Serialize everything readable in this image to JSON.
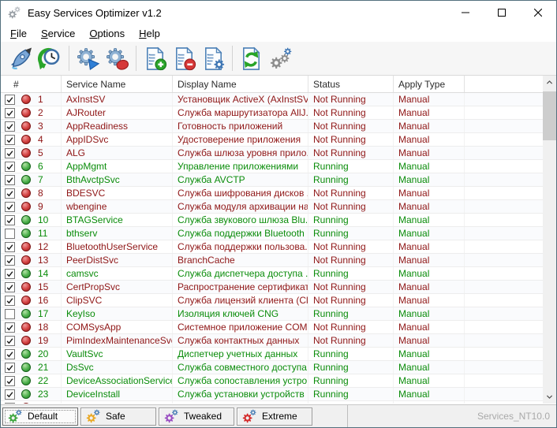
{
  "window": {
    "title": "Easy Services Optimizer v1.2"
  },
  "menu": {
    "items": [
      {
        "label": "File"
      },
      {
        "label": "Service"
      },
      {
        "label": "Options"
      },
      {
        "label": "Help"
      }
    ]
  },
  "toolbar": {
    "icons": [
      "rocket-icon",
      "history-clock-icon",
      "start-service-gear-icon",
      "stop-service-gear-icon",
      "add-service-doc-icon",
      "remove-service-doc-icon",
      "configure-service-doc-icon",
      "refresh-doc-icon",
      "settings-gears-icon"
    ]
  },
  "table": {
    "columns": [
      "#",
      "Service Name",
      "Display Name",
      "Status",
      "Apply Type"
    ],
    "rows": [
      {
        "num": "1",
        "checked": true,
        "state": "stopped",
        "service": "AxInstSV",
        "display": "Установщик ActiveX (AxInstSV)",
        "status": "Not Running",
        "apply": "Manual"
      },
      {
        "num": "2",
        "checked": true,
        "state": "stopped",
        "service": "AJRouter",
        "display": "Служба маршрутизатора AllJ...",
        "status": "Not Running",
        "apply": "Manual"
      },
      {
        "num": "3",
        "checked": true,
        "state": "stopped",
        "service": "AppReadiness",
        "display": "Готовность приложений",
        "status": "Not Running",
        "apply": "Manual"
      },
      {
        "num": "4",
        "checked": true,
        "state": "stopped",
        "service": "AppIDSvc",
        "display": "Удостоверение приложения",
        "status": "Not Running",
        "apply": "Manual"
      },
      {
        "num": "5",
        "checked": true,
        "state": "stopped",
        "service": "ALG",
        "display": "Служба шлюза уровня прило...",
        "status": "Not Running",
        "apply": "Manual"
      },
      {
        "num": "6",
        "checked": true,
        "state": "running",
        "service": "AppMgmt",
        "display": "Управление приложениями",
        "status": "Running",
        "apply": "Manual"
      },
      {
        "num": "7",
        "checked": true,
        "state": "running",
        "service": "BthAvctpSvc",
        "display": "Служба AVCTP",
        "status": "Running",
        "apply": "Manual"
      },
      {
        "num": "8",
        "checked": true,
        "state": "stopped",
        "service": "BDESVC",
        "display": "Служба шифрования дисков ...",
        "status": "Not Running",
        "apply": "Manual"
      },
      {
        "num": "9",
        "checked": true,
        "state": "stopped",
        "service": "wbengine",
        "display": "Служба модуля архивации на...",
        "status": "Not Running",
        "apply": "Manual"
      },
      {
        "num": "10",
        "checked": true,
        "state": "running",
        "service": "BTAGService",
        "display": "Служба звукового шлюза Blu...",
        "status": "Running",
        "apply": "Manual"
      },
      {
        "num": "11",
        "checked": false,
        "state": "running",
        "service": "bthserv",
        "display": "Служба поддержки Bluetooth",
        "status": "Running",
        "apply": "Manual"
      },
      {
        "num": "12",
        "checked": true,
        "state": "stopped",
        "service": "BluetoothUserService",
        "display": "Служба поддержки пользова...",
        "status": "Not Running",
        "apply": "Manual"
      },
      {
        "num": "13",
        "checked": true,
        "state": "stopped",
        "service": "PeerDistSvc",
        "display": "BranchCache",
        "status": "Not Running",
        "apply": "Manual"
      },
      {
        "num": "14",
        "checked": true,
        "state": "running",
        "service": "camsvc",
        "display": "Служба диспетчера доступа ...",
        "status": "Running",
        "apply": "Manual"
      },
      {
        "num": "15",
        "checked": true,
        "state": "stopped",
        "service": "CertPropSvc",
        "display": "Распространение сертификата",
        "status": "Not Running",
        "apply": "Manual"
      },
      {
        "num": "16",
        "checked": true,
        "state": "stopped",
        "service": "ClipSVC",
        "display": "Служба лицензий клиента (Cl...",
        "status": "Not Running",
        "apply": "Manual"
      },
      {
        "num": "17",
        "checked": false,
        "state": "running",
        "service": "KeyIso",
        "display": "Изоляция ключей CNG",
        "status": "Running",
        "apply": "Manual"
      },
      {
        "num": "18",
        "checked": true,
        "state": "stopped",
        "service": "COMSysApp",
        "display": "Системное приложение COM+",
        "status": "Not Running",
        "apply": "Manual"
      },
      {
        "num": "19",
        "checked": true,
        "state": "stopped",
        "service": "PimIndexMaintenanceSvc",
        "display": "Служба контактных данных",
        "status": "Not Running",
        "apply": "Manual"
      },
      {
        "num": "20",
        "checked": true,
        "state": "running",
        "service": "VaultSvc",
        "display": "Диспетчер учетных данных",
        "status": "Running",
        "apply": "Manual"
      },
      {
        "num": "21",
        "checked": true,
        "state": "running",
        "service": "DsSvc",
        "display": "Служба совместного доступа...",
        "status": "Running",
        "apply": "Manual"
      },
      {
        "num": "22",
        "checked": true,
        "state": "running",
        "service": "DeviceAssociationService",
        "display": "Служба сопоставления устро...",
        "status": "Running",
        "apply": "Manual"
      },
      {
        "num": "23",
        "checked": true,
        "state": "running",
        "service": "DeviceInstall",
        "display": "Служба установки устройств",
        "status": "Running",
        "apply": "Manual"
      },
      {
        "num": "",
        "checked": true,
        "state": "stopped",
        "service": "",
        "display": "",
        "status": "",
        "apply": ""
      }
    ]
  },
  "tabs": [
    {
      "label": "Default",
      "gear_color": "#3ea53e",
      "active": true
    },
    {
      "label": "Safe",
      "gear_color": "#e9a823",
      "active": false
    },
    {
      "label": "Tweaked",
      "gear_color": "#9a4ec2",
      "active": false
    },
    {
      "label": "Extreme",
      "gear_color": "#d42a2a",
      "active": false
    }
  ],
  "statusbar": {
    "right_text": "Services_NT10.0"
  },
  "colors": {
    "running_text": "#0a8c0a",
    "stopped_text": "#8f1616",
    "accent_blue": "#4a7fb5"
  }
}
